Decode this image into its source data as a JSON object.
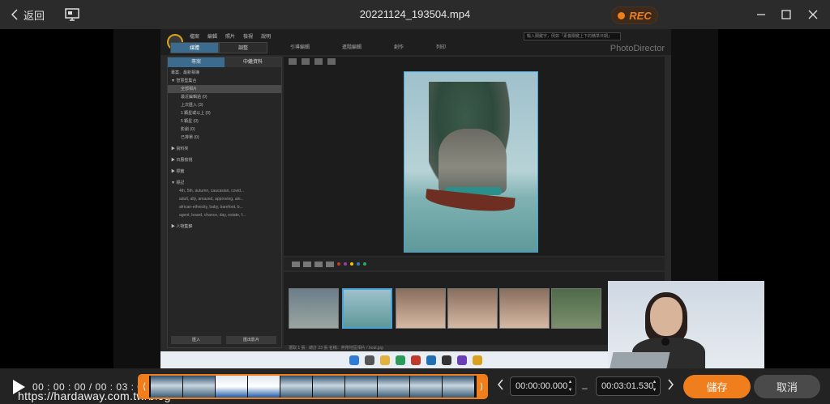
{
  "titlebar": {
    "back_label": "返回",
    "file_name": "20221124_193504.mp4",
    "rec_label": "REC"
  },
  "video_frame": {
    "app_brand": "PhotoDirector",
    "menu": [
      "檔案",
      "編輯",
      "照片",
      "檢視",
      "說明"
    ],
    "mode_tabs": [
      "媒體",
      "調整"
    ],
    "module_tabs": [
      "引導編輯",
      "進階編輯",
      "創作",
      "列印"
    ],
    "panel_tabs": [
      "專案",
      "中繼資料"
    ],
    "search_placeholder": "輸入關鍵字，例如「素養關鍵上下的精準日期」",
    "tree": [
      "專案．最新相簿",
      "▼ 智慧型集合",
      "全部相片",
      "最近編輯過 (0)",
      "上次匯入 (3)",
      "1 顆星或以上 (0)",
      "5 顆星 (0)",
      "影劇 (0)",
      "已排單 (0)",
      "▶ 資料夾",
      "▶ 日曆檢視",
      "▶ 標籤",
      "▼ 標記",
      "4th, 5th, autumn, caucasian, covid...",
      "adult, ally, amazed, approving, ani...",
      "african-ethnicity, baby, barefoot, b...",
      "agent, board, chance, day, estate, f...",
      "▶ 人物集錦"
    ],
    "panel_buttons": [
      "匯入",
      "匯出影片"
    ],
    "status_text": "選取 1 張 · 總計 23 張    名稱：熱帶地區相片 / boat.jpg"
  },
  "bottombar": {
    "current_time": "00 : 00 : 00 / 00 : 03 : 01",
    "watermark_url": "https://hardaway.com.tw/blog",
    "start_time": "00:00:00.000",
    "end_time": "00:03:01.530",
    "save_label": "儲存",
    "cancel_label": "取消"
  },
  "colors": {
    "accent": "#f07e1c",
    "titlebar_bg": "#2b2b2b",
    "bottombar_bg": "#232323"
  },
  "icons": {
    "back": "chevron-left-icon",
    "screen": "monitor-icon",
    "record": "record-dot-icon",
    "minimize": "minimize-icon",
    "maximize": "maximize-icon",
    "close": "close-icon",
    "play": "play-icon"
  }
}
